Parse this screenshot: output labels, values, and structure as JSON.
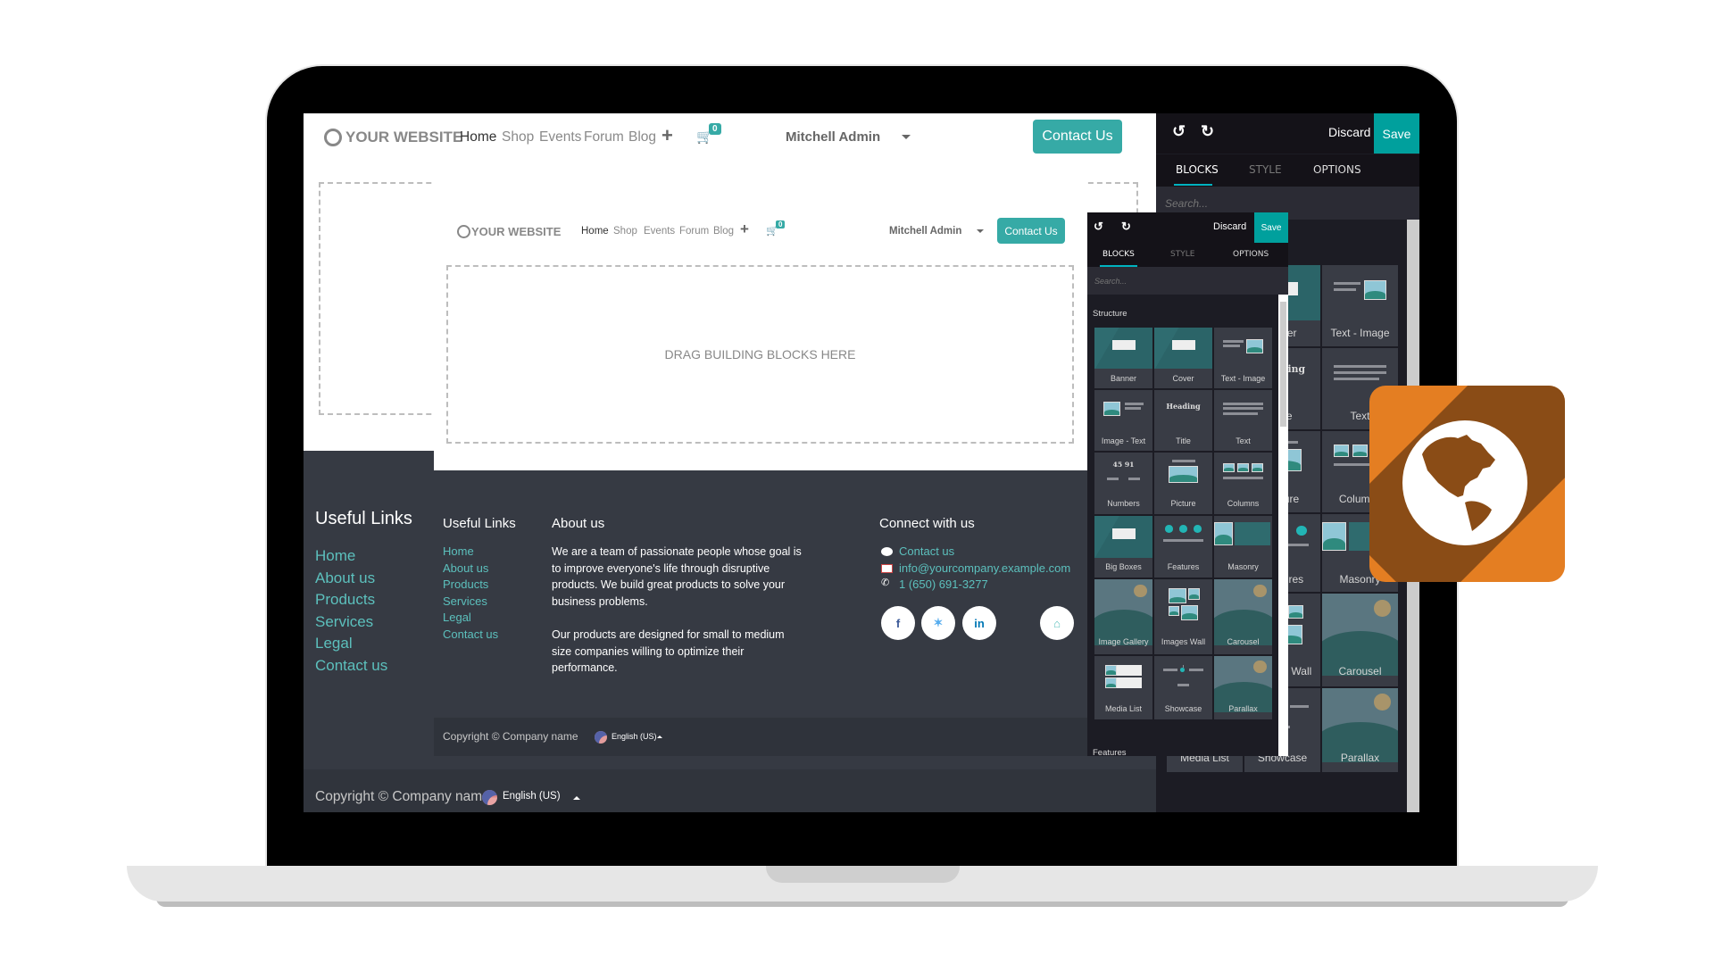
{
  "site": {
    "logo": "YOUR WEBSITE",
    "nav": [
      "Home",
      "Shop",
      "Events",
      "Forum",
      "Blog"
    ],
    "cart_count": "0",
    "user": "Mitchell Admin",
    "contact_button": "Contact Us"
  },
  "dropzone": "DRAG BUILDING BLOCKS HERE",
  "footer": {
    "useful_links_title": "Useful Links",
    "links": [
      "Home",
      "About us",
      "Products",
      "Services",
      "Legal",
      "Contact us"
    ],
    "about_title": "About us",
    "about_p1": "We are a team of passionate people whose goal is to improve everyone's life through disruptive products. We build great products to solve your business problems.",
    "about_p2": "Our products are designed for small to medium size companies willing to optimize their performance.",
    "connect_title": "Connect with us",
    "contact_link": "Contact us",
    "email": "info@yourcompany.example.com",
    "phone": "1 (650) 691-3277",
    "social": [
      "f",
      "t",
      "in",
      "home"
    ],
    "copyright": "Copyright © Company name",
    "language": "English (US)"
  },
  "editor": {
    "discard": "Discard",
    "save": "Save",
    "tabs": [
      "BLOCKS",
      "STYLE",
      "OPTIONS"
    ],
    "active_tab": "BLOCKS",
    "search_placeholder": "Search...",
    "section_structure": "Structure",
    "section_features": "Features",
    "blocks": [
      {
        "label": "Banner",
        "kind": "teal"
      },
      {
        "label": "Cover",
        "kind": "teal"
      },
      {
        "label": "Text - Image",
        "kind": "textimg"
      },
      {
        "label": "Image - Text",
        "kind": "imgtext"
      },
      {
        "label": "Title",
        "kind": "heading",
        "glyph": "Heading"
      },
      {
        "label": "Text",
        "kind": "text"
      },
      {
        "label": "Numbers",
        "kind": "numbers",
        "glyph": "45 91"
      },
      {
        "label": "Picture",
        "kind": "picture"
      },
      {
        "label": "Columns",
        "kind": "columns"
      },
      {
        "label": "Big Boxes",
        "kind": "teal"
      },
      {
        "label": "Features",
        "kind": "features"
      },
      {
        "label": "Masonry",
        "kind": "masonry"
      },
      {
        "label": "Image Gallery",
        "kind": "land"
      },
      {
        "label": "Images Wall",
        "kind": "wall"
      },
      {
        "label": "Carousel",
        "kind": "land"
      },
      {
        "label": "Media List",
        "kind": "media"
      },
      {
        "label": "Showcase",
        "kind": "showcase"
      },
      {
        "label": "Parallax",
        "kind": "land"
      }
    ]
  },
  "colors": {
    "accent": "#00a09d",
    "footer": "#363a43",
    "badge": "#e47e22",
    "link": "#5cc0bd"
  },
  "badge_icon": "globe-americas-icon"
}
